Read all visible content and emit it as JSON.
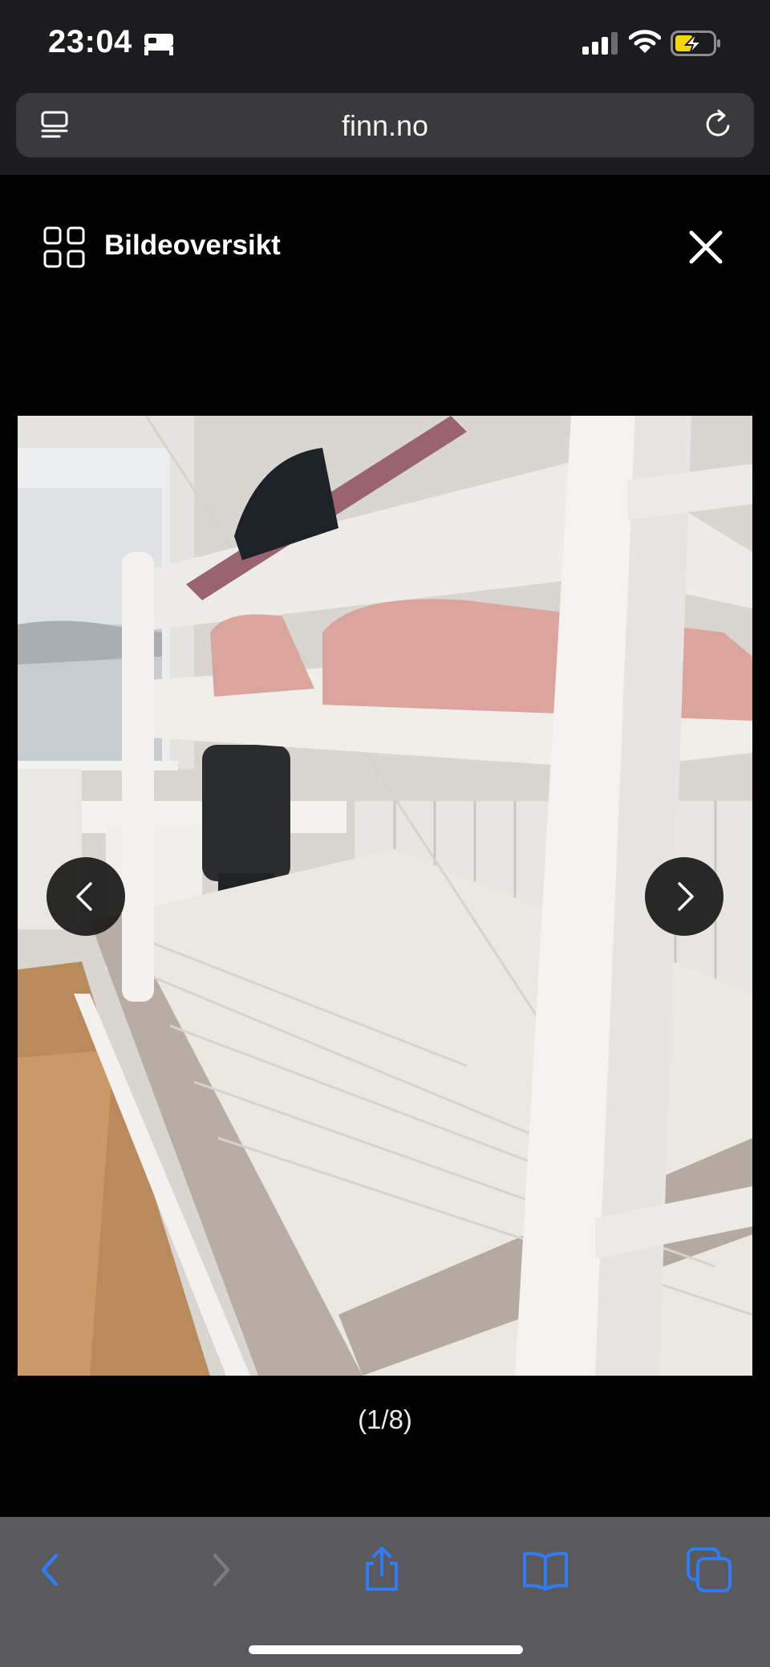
{
  "status_bar": {
    "time": "23:04",
    "icons": [
      "bed-icon",
      "cellular-signal-icon",
      "wifi-icon",
      "battery-charging-icon"
    ],
    "battery_color": "#f5d60a"
  },
  "browser": {
    "url": "finn.no",
    "left_icon": "reader-mode-icon",
    "right_icon": "reload-icon"
  },
  "gallery": {
    "overview_label": "Bildeoversikt",
    "overview_icon": "grid-icon",
    "close_icon": "close-icon",
    "counter": "(1/8)",
    "prev_icon": "chevron-left-icon",
    "next_icon": "chevron-right-icon",
    "image_subject": "photo"
  },
  "toolbar": {
    "items": [
      "back-icon",
      "forward-icon",
      "share-icon",
      "bookmarks-icon",
      "tabs-icon"
    ],
    "accent": "#2f7cf6"
  }
}
